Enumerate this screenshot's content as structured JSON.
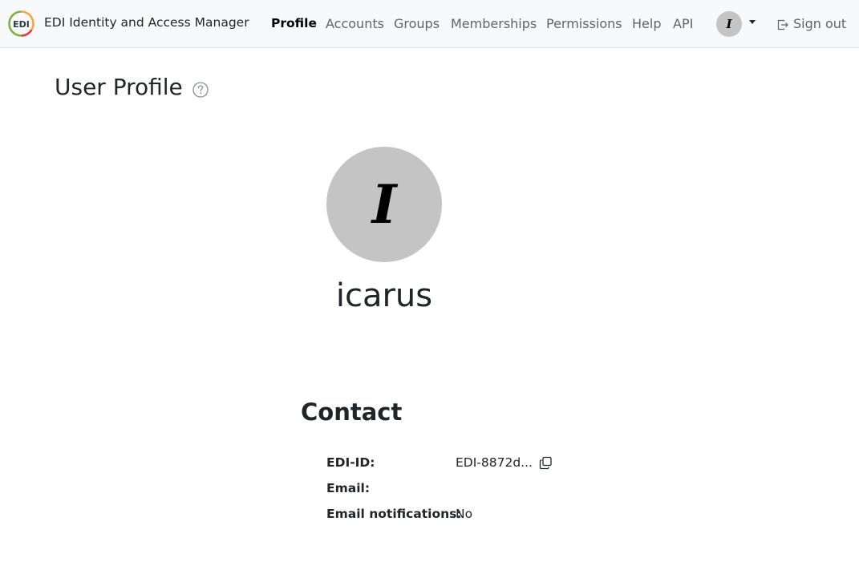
{
  "brand": {
    "title": "EDI Identity and Access Manager",
    "logo_text": "EDI",
    "colors": {
      "green": "#7cb342",
      "red": "#e53935",
      "orange": "#f4a742"
    }
  },
  "nav": {
    "items": [
      {
        "label": "Profile",
        "active": true
      },
      {
        "label": "Accounts",
        "active": false
      },
      {
        "label": "Groups",
        "active": false
      },
      {
        "label": "Memberships",
        "active": false
      },
      {
        "label": "Permissions",
        "active": false
      },
      {
        "label": "Help",
        "active": false
      },
      {
        "label": "API",
        "active": false
      }
    ],
    "avatar_initial": "I",
    "signout_label": "Sign out",
    "signout_icon": "sign-out-icon"
  },
  "page": {
    "title": "User Profile",
    "help_icon": "question-circle-icon"
  },
  "profile": {
    "avatar_initial": "I",
    "username": "icarus"
  },
  "contact": {
    "title": "Contact",
    "fields": [
      {
        "label": "EDI-ID:",
        "value": "EDI-8872d..."
      },
      {
        "label": "Email:",
        "value": ""
      },
      {
        "label": "Email notifications:",
        "value": "No"
      }
    ],
    "copy_icon": "copy-icon"
  }
}
